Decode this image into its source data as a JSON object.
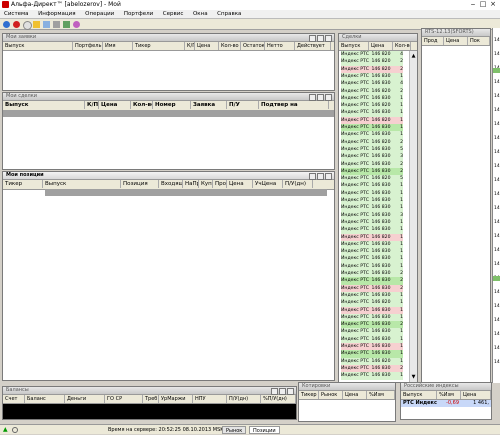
{
  "window": {
    "title": "Альфа-Директ™ [abelozerov] - Мой"
  },
  "menu": [
    "Система",
    "Информация",
    "Операции",
    "Портфели",
    "Сервис",
    "Окна",
    "Справка"
  ],
  "orders_panel": {
    "title": "Мои заявки",
    "columns": [
      "Выпуск",
      "Портфель",
      "Имя",
      "Тикер",
      "К/П",
      "Цена",
      "Кол-во",
      "Остаток",
      "Нетто",
      "Действует"
    ]
  },
  "trades_panel": {
    "title": "Мои сделки",
    "columns": [
      "Выпуск",
      "К/П",
      "Цена",
      "Кол-во",
      "Номер",
      "Заявка",
      "П/У",
      "Подтвер на"
    ]
  },
  "positions_panel": {
    "title": "Мои позиции",
    "columns": [
      "Тикер",
      "Выпуск",
      "Позиция",
      "ВходящНаПо",
      "НаПр",
      "Купл",
      "Прод",
      "Цена",
      "УчЦена",
      "П/У(дн)"
    ]
  },
  "balances_panel": {
    "title": "Балансы",
    "columns": [
      "Счет",
      "Баланс",
      "Деньги",
      "ГО СР",
      "Треб",
      "УрМаржи",
      "НПУ",
      "П/У(дн)",
      "%П/У(дн)"
    ]
  },
  "watch_panel": {
    "title": "Котировки",
    "columns": [
      "Тикер",
      "Рынок",
      "Цена",
      "%Изм"
    ]
  },
  "deals_panel": {
    "title": "Сделки",
    "columns": [
      "Выпуск",
      "Цена",
      "Кол-во"
    ],
    "rows": [
      {
        "instr": "Индекс РТС (",
        "price": "146 820",
        "qty": "4",
        "side": "b"
      },
      {
        "instr": "Индекс РТС (",
        "price": "146 820",
        "qty": "2",
        "side": "b"
      },
      {
        "instr": "Индекс РТС (",
        "price": "146 820",
        "qty": "2",
        "side": "s"
      },
      {
        "instr": "Индекс РТС (",
        "price": "146 830",
        "qty": "1",
        "side": "b"
      },
      {
        "instr": "Индекс РТС (",
        "price": "146 830",
        "qty": "4",
        "side": "b"
      },
      {
        "instr": "Индекс РТС (",
        "price": "146 820",
        "qty": "2",
        "side": "b"
      },
      {
        "instr": "Индекс РТС (",
        "price": "146 830",
        "qty": "1",
        "side": "b"
      },
      {
        "instr": "Индекс РТС (",
        "price": "146 820",
        "qty": "1",
        "side": "b"
      },
      {
        "instr": "Индекс РТС (",
        "price": "146 830",
        "qty": "1",
        "side": "b"
      },
      {
        "instr": "Индекс РТС (",
        "price": "146 820",
        "qty": "1",
        "side": "s"
      },
      {
        "instr": "Индекс РТС (",
        "price": "146 830",
        "qty": "1",
        "side": "g"
      },
      {
        "instr": "Индекс РТС (",
        "price": "146 830",
        "qty": "1",
        "side": "b"
      },
      {
        "instr": "Индекс РТС (",
        "price": "146 820",
        "qty": "2",
        "side": "b"
      },
      {
        "instr": "Индекс РТС (",
        "price": "146 830",
        "qty": "5",
        "side": "b"
      },
      {
        "instr": "Индекс РТС (",
        "price": "146 830",
        "qty": "3",
        "side": "b"
      },
      {
        "instr": "Индекс РТС (",
        "price": "146 830",
        "qty": "2",
        "side": "b"
      },
      {
        "instr": "Индекс РТС (",
        "price": "146 830",
        "qty": "2",
        "side": "g"
      },
      {
        "instr": "Индекс РТС (",
        "price": "146 820",
        "qty": "5",
        "side": "b"
      },
      {
        "instr": "Индекс РТС (",
        "price": "146 830",
        "qty": "1",
        "side": "b"
      },
      {
        "instr": "Индекс РТС (",
        "price": "146 830",
        "qty": "1",
        "side": "b"
      },
      {
        "instr": "Индекс РТС (",
        "price": "146 830",
        "qty": "1",
        "side": "b"
      },
      {
        "instr": "Индекс РТС (",
        "price": "146 830",
        "qty": "1",
        "side": "b"
      },
      {
        "instr": "Индекс РТС (",
        "price": "146 830",
        "qty": "3",
        "side": "b"
      },
      {
        "instr": "Индекс РТС (",
        "price": "146 830",
        "qty": "1",
        "side": "b"
      },
      {
        "instr": "Индекс РТС (",
        "price": "146 830",
        "qty": "1",
        "side": "b"
      },
      {
        "instr": "Индекс РТС (",
        "price": "146 820",
        "qty": "1",
        "side": "s"
      },
      {
        "instr": "Индекс РТС (",
        "price": "146 830",
        "qty": "1",
        "side": "b"
      },
      {
        "instr": "Индекс РТС (",
        "price": "146 830",
        "qty": "1",
        "side": "b"
      },
      {
        "instr": "Индекс РТС (",
        "price": "146 830",
        "qty": "1",
        "side": "b"
      },
      {
        "instr": "Индекс РТС (",
        "price": "146 830",
        "qty": "1",
        "side": "b"
      },
      {
        "instr": "Индекс РТС (",
        "price": "146 830",
        "qty": "2",
        "side": "b"
      },
      {
        "instr": "Индекс РТС (",
        "price": "146 830",
        "qty": "2",
        "side": "g"
      },
      {
        "instr": "Индекс РТС (",
        "price": "146 830",
        "qty": "2",
        "side": "s"
      },
      {
        "instr": "Индекс РТС (",
        "price": "146 830",
        "qty": "1",
        "side": "b"
      },
      {
        "instr": "Индекс РТС (",
        "price": "146 820",
        "qty": "1",
        "side": "b"
      },
      {
        "instr": "Индекс РТС (",
        "price": "146 830",
        "qty": "1",
        "side": "s"
      },
      {
        "instr": "Индекс РТС (",
        "price": "146 830",
        "qty": "1",
        "side": "b"
      },
      {
        "instr": "Индекс РТС (",
        "price": "146 830",
        "qty": "2",
        "side": "g"
      },
      {
        "instr": "Индекс РТС (",
        "price": "146 830",
        "qty": "1",
        "side": "b"
      },
      {
        "instr": "Индекс РТС (",
        "price": "146 830",
        "qty": "1",
        "side": "b"
      },
      {
        "instr": "Индекс РТС (",
        "price": "146 830",
        "qty": "1",
        "side": "s"
      },
      {
        "instr": "Индекс РТС (",
        "price": "146 830",
        "qty": "1",
        "side": "g"
      },
      {
        "instr": "Индекс РТС (",
        "price": "146 820",
        "qty": "1",
        "side": "b"
      },
      {
        "instr": "Индекс РТС (",
        "price": "146 830",
        "qty": "2",
        "side": "s"
      },
      {
        "instr": "Индекс РТС (",
        "price": "146 830",
        "qty": "1",
        "side": "b"
      }
    ]
  },
  "orderbook_panel": {
    "title": "RTS-12.13(SFORTS)",
    "columns": [
      "Прод",
      "Цена",
      "Пок"
    ]
  },
  "indices_panel": {
    "title": "Российские индексы",
    "columns": [
      "Выпуск",
      "%Изм",
      "Цена"
    ],
    "row": {
      "name": "РТС Индекс",
      "change": "-0,69",
      "price": "1 461,"
    }
  },
  "price_ticks": [
    "147",
    "147",
    "147",
    "147",
    "147",
    "147",
    "146",
    "146",
    "146",
    "146",
    "146",
    "146",
    "146",
    "146",
    "146",
    "146",
    "146",
    "146",
    "146",
    "146",
    "146",
    "146",
    "146",
    "146"
  ],
  "status": {
    "server_time": "Время на сервере: 20:52:25 08.10.2013 MSK",
    "tab1": "Рынок",
    "tab2": "Позиции"
  },
  "colors": {
    "buy_row": "#d8f2d0",
    "sell_row": "#f6d0d0",
    "green_row": "#b8e8a8",
    "index_row": "#c8d8f8"
  }
}
